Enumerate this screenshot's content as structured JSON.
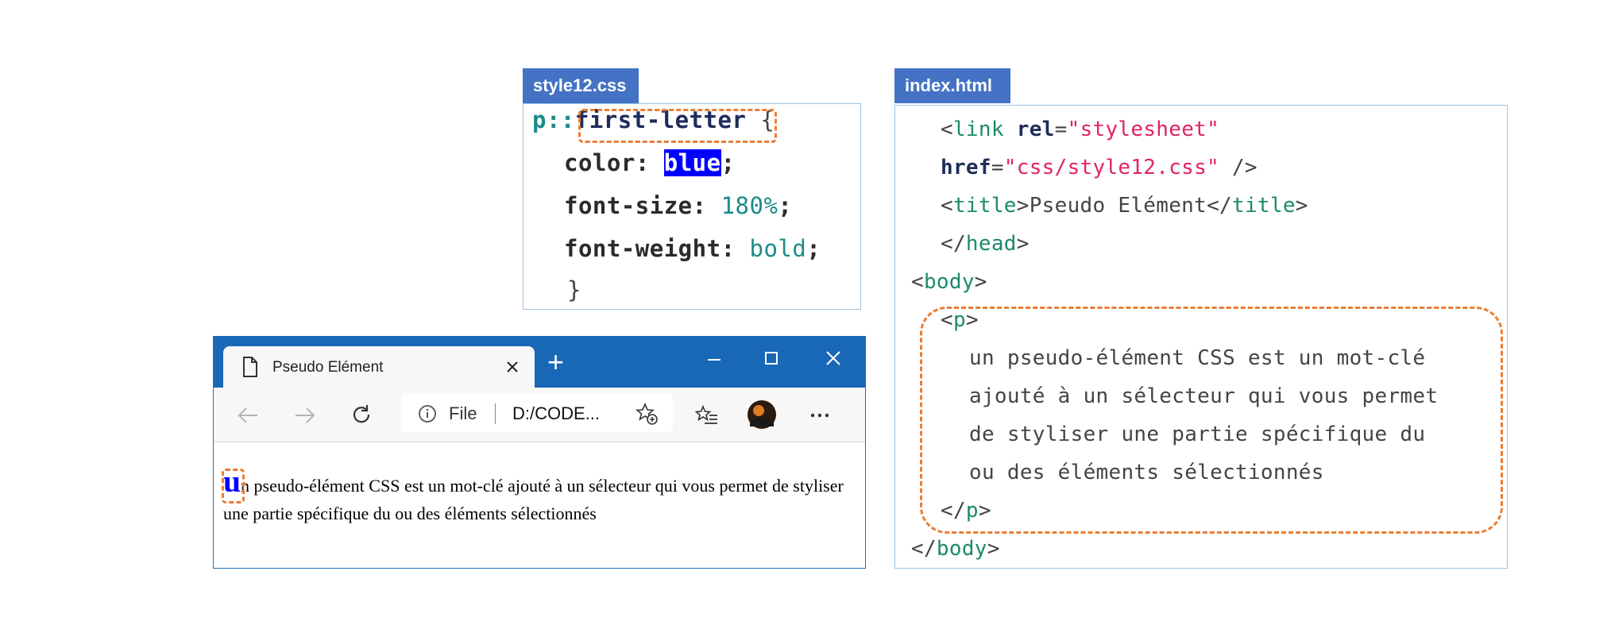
{
  "css_panel": {
    "tab_label": "style12.css",
    "selector_prefix": "p::",
    "selector_name": "first-letter",
    "open_brace": " {",
    "props": [
      {
        "name": "color",
        "value": "blue",
        "end": ";"
      },
      {
        "name": "font-size",
        "value": "180%",
        "end": ";"
      },
      {
        "name": "font-weight",
        "value": "bold",
        "end": ";"
      }
    ],
    "close_brace": "}"
  },
  "html_panel": {
    "tab_label": "index.html",
    "link_open": "<",
    "link_tag": "link",
    "rel_attr": "rel",
    "rel_value": "\"stylesheet\"",
    "href_attr": "href",
    "href_value": "\"css/style12.css\"",
    "link_close": " />",
    "title_text": "Pseudo Elément",
    "title_tag": "title",
    "head_tag": "head",
    "body_tag": "body",
    "p_tag": "p",
    "p_lines": [
      "un pseudo-élément CSS est un mot-clé",
      "ajouté à un sélecteur qui vous permet",
      "de styliser une partie spécifique du",
      "ou des éléments sélectionnés"
    ]
  },
  "browser": {
    "tab_title": "Pseudo Elément",
    "new_tab": "+",
    "url_scheme": "File",
    "url_path": "D:/CODE...",
    "first_letter": "u",
    "paragraph_rest": "n pseudo-élément CSS est un mot-clé ajouté à un sélecteur qui vous permet de styliser une partie spécifique du ou des éléments sélectionnés"
  },
  "colors": {
    "accent_orange": "#ed7d31",
    "tag_blue": "#4472C4",
    "browser_blue": "#1868b7",
    "first_letter_color": "#0000ff"
  }
}
